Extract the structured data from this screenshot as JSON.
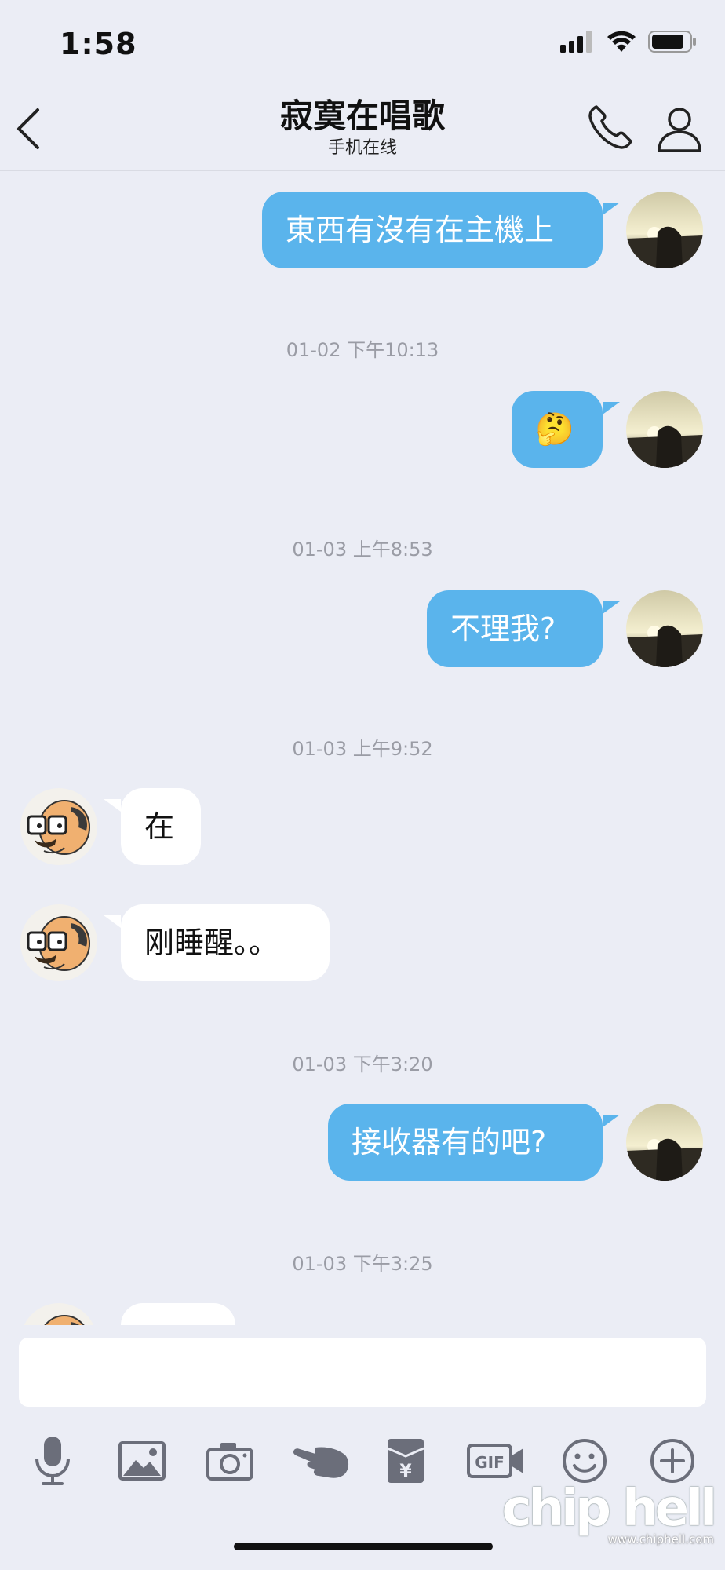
{
  "status_bar": {
    "time": "1:58"
  },
  "header": {
    "title": "寂寞在唱歌",
    "subtitle": "手机在线"
  },
  "messages": [
    {
      "type": "sent",
      "text": "東西有沒有在主機上"
    },
    {
      "type": "timestamp",
      "text": "01-02 下午10:13"
    },
    {
      "type": "sent",
      "text": "🤔"
    },
    {
      "type": "timestamp",
      "text": "01-03 上午8:53"
    },
    {
      "type": "sent",
      "text": "不理我?"
    },
    {
      "type": "timestamp",
      "text": "01-03 上午9:52"
    },
    {
      "type": "received",
      "text": "在"
    },
    {
      "type": "received",
      "text": "刚睡醒。。"
    },
    {
      "type": "timestamp",
      "text": "01-03 下午3:20"
    },
    {
      "type": "sent",
      "text": "接收器有的吧?"
    },
    {
      "type": "timestamp",
      "text": "01-03 下午3:25"
    }
  ],
  "input": {
    "placeholder": ""
  },
  "toolbar": {
    "items": [
      "microphone",
      "image",
      "camera",
      "poke",
      "red-packet",
      "gif",
      "emoji",
      "plus"
    ],
    "gif_label": "GIF",
    "yen_label": "¥"
  },
  "watermark": {
    "logo": "chip hell",
    "url": "www.chiphell.com"
  },
  "colors": {
    "sent_bubble": "#5ab4ec",
    "received_bubble": "#ffffff",
    "background": "#ebedf5"
  }
}
